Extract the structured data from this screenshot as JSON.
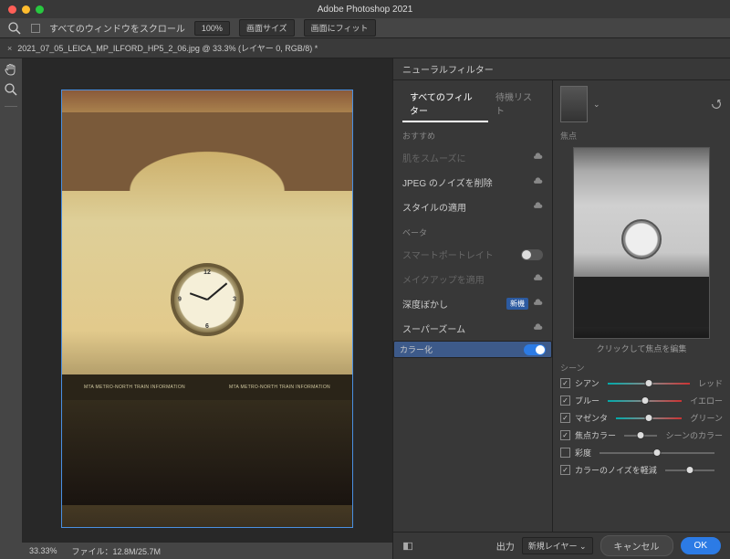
{
  "title": "Adobe Photoshop 2021",
  "options": {
    "scroll_all": "すべてのウィンドウをスクロール",
    "zoom_pct": "100%",
    "fit_screen": "画面サイズ",
    "fit_window": "画面にフィット"
  },
  "tab": {
    "name": "2021_07_05_LEICA_MP_ILFORD_HP5_2_06.jpg @ 33.3% (レイヤー 0, RGB/8) *"
  },
  "status": {
    "zoom": "33.33%",
    "file": "ファイル：12.8M/25.7M"
  },
  "panel": {
    "title": "ニューラルフィルター",
    "tabs": {
      "all": "すべてのフィルター",
      "wait": "待機リスト"
    },
    "sections": {
      "featured": "おすすめ",
      "beta": "ベータ"
    },
    "filters": {
      "smooth_skin": "肌をスムーズに",
      "jpeg_noise": "JPEG のノイズを削除",
      "style_transfer": "スタイルの適用",
      "smart_portrait": "スマートポートレイト",
      "makeup": "メイクアップを適用",
      "depth_blur": "深度ぼかし",
      "depth_badge": "新機",
      "super_zoom": "スーパーズーム",
      "colorize": "カラー化"
    },
    "preview": {
      "focus_label": "焦点",
      "hint": "クリックして焦点を編集"
    },
    "scene": {
      "heading": "シーン",
      "sliders": [
        {
          "left": "シアン",
          "right": "レッド",
          "checked": true
        },
        {
          "left": "ブルー",
          "right": "イエロー",
          "checked": true
        },
        {
          "left": "マゼンタ",
          "right": "グリーン",
          "checked": true
        },
        {
          "left": "焦点カラー",
          "right": "シーンのカラー",
          "checked": true
        },
        {
          "left": "彩度",
          "right": "",
          "checked": false
        },
        {
          "left": "カラーのノイズを軽減",
          "right": "",
          "checked": true
        }
      ]
    },
    "footer": {
      "output_label": "出力",
      "output_value": "新規レイヤー",
      "cancel": "キャンセル",
      "ok": "OK"
    }
  },
  "booth_sign": "MTA METRO-NORTH TRAIN INFORMATION"
}
